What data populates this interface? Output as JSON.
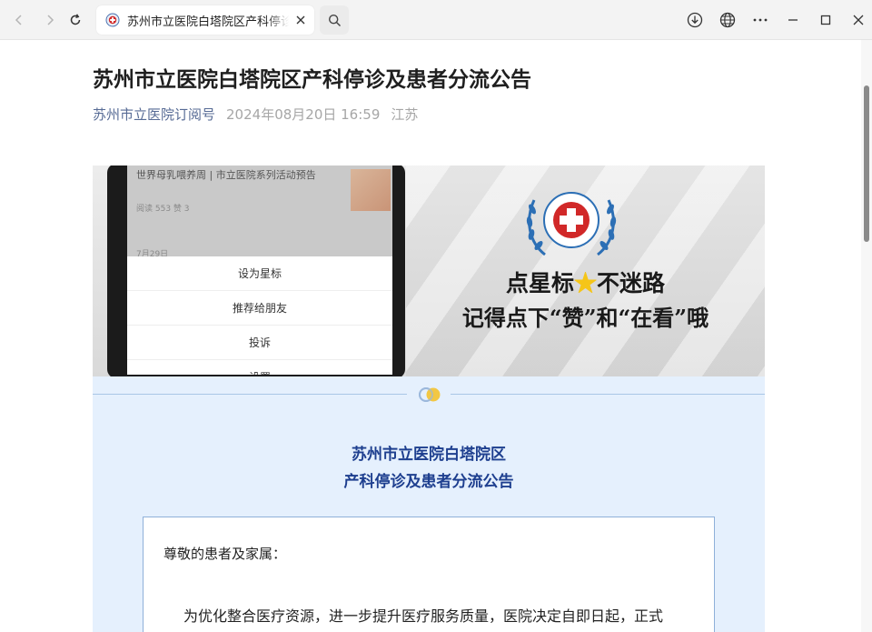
{
  "browser": {
    "tab_title": "苏州市立医院白塔院区产科停诊及患者分流公告",
    "accent_color": "#576b95"
  },
  "article": {
    "title": "苏州市立医院白塔院区产科停诊及患者分流公告",
    "account": "苏州市立医院订阅号",
    "time": "2024年08月20日 16:59",
    "location": "江苏"
  },
  "banner": {
    "feed_title": "世界母乳喂养周 | 市立医院系列活动预告",
    "feed_stats": "阅读 553  赞 3",
    "feed_date": "7月29日",
    "menu": [
      "设为星标",
      "推荐给朋友",
      "投诉",
      "设置"
    ],
    "slogan_a": "点星标",
    "slogan_b": "不迷路",
    "slogan_line2": "记得点下“赞”和“在看”哦"
  },
  "notice": {
    "title_line1": "苏州市立医院白塔院区",
    "title_line2": "产科停诊及患者分流公告",
    "salutation": "尊敬的患者及家属：",
    "body_first_line": "为优化整合医疗资源，进一步提升医疗服务质量，医院决定自即日起，正式"
  }
}
